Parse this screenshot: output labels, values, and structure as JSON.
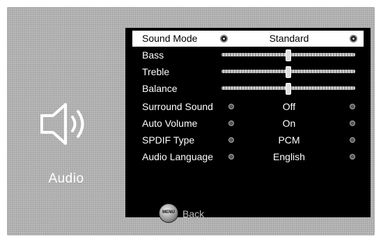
{
  "category": {
    "label": "Audio",
    "icon": "speaker-icon"
  },
  "menu": {
    "rows": [
      {
        "label": "Sound Mode",
        "value": "Standard",
        "type": "option",
        "selected": true
      },
      {
        "label": "Bass",
        "type": "slider",
        "level": 0.5
      },
      {
        "label": "Treble",
        "type": "slider",
        "level": 0.5
      },
      {
        "label": "Balance",
        "type": "slider",
        "level": 0.5
      },
      {
        "label": "Surround Sound",
        "value": "Off",
        "type": "option"
      },
      {
        "label": "Auto Volume",
        "value": "On",
        "type": "option"
      },
      {
        "label": "SPDIF Type",
        "value": "PCM",
        "type": "option"
      },
      {
        "label": "Audio Language",
        "value": "English",
        "type": "option"
      }
    ]
  },
  "footer": {
    "menu_button_label": "MENU",
    "back_label": "Back"
  },
  "colors": {
    "panel": "#000000",
    "background": "#b8b8b8",
    "highlight": "#ffffff",
    "text": "#ffffff"
  }
}
